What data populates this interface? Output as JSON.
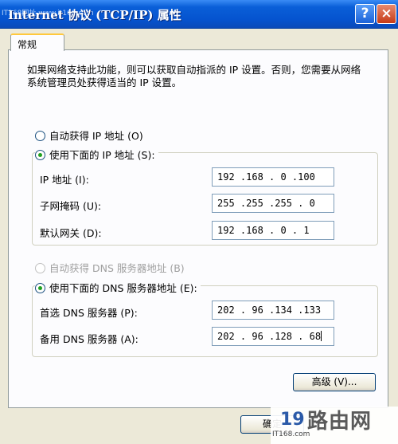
{
  "window": {
    "title": "Internet 协议 (TCP/IP) 属性",
    "watermark_top": "IT168网址 www.it168.com",
    "help_label": "?",
    "close_label": "×"
  },
  "tabs": [
    {
      "label": "常规"
    }
  ],
  "description": "如果网络支持此功能，则可以获取自动指派的 IP 设置。否则，您需要从网络系统管理员处获得适当的 IP 设置。",
  "ip_section": {
    "auto_label": "自动获得 IP 地址 (O)",
    "manual_label": "使用下面的 IP 地址 (S):",
    "selected": "manual",
    "fields": [
      {
        "label": "IP 地址 (I):",
        "value": "192 .168 . 0 .100"
      },
      {
        "label": "子网掩码 (U):",
        "value": "255 .255 .255 . 0"
      },
      {
        "label": "默认网关 (D):",
        "value": "192 .168 . 0 . 1"
      }
    ]
  },
  "dns_section": {
    "auto_label": "自动获得 DNS 服务器地址 (B)",
    "manual_label": "使用下面的 DNS 服务器地址 (E):",
    "selected": "manual",
    "fields": [
      {
        "label": "首选 DNS 服务器 (P):",
        "value": "202 . 96 .134 .133"
      },
      {
        "label": "备用 DNS 服务器 (A):",
        "value": "202 . 96 .128 . 68"
      }
    ]
  },
  "buttons": {
    "advanced": "高级 (V)...",
    "ok": "确定"
  },
  "watermark_bottom": {
    "brand": "路由网",
    "logo": "19",
    "url": "IT168.com"
  }
}
